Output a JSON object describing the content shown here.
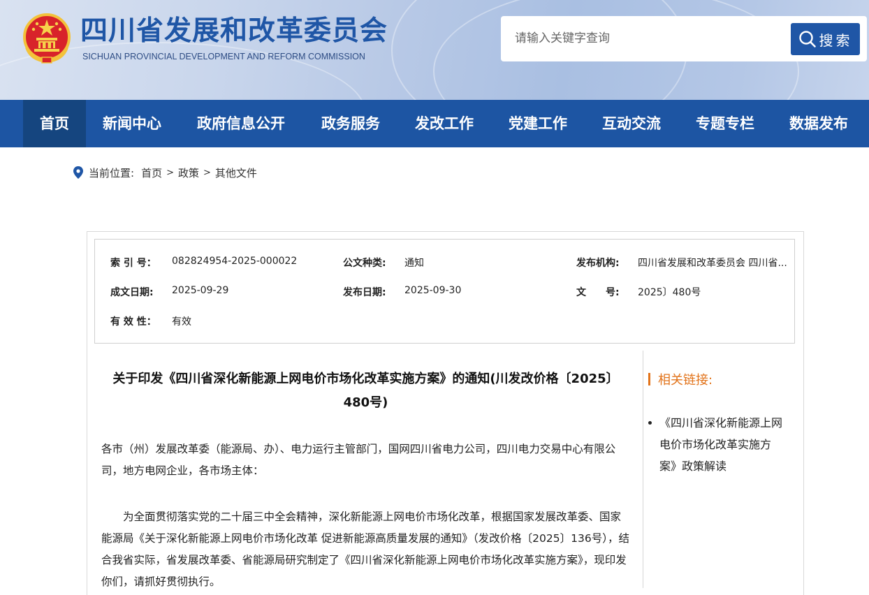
{
  "header": {
    "site_title": "四川省发展和改革委员会",
    "site_subtitle": "SICHUAN PROVINCIAL DEVELOPMENT AND REFORM COMMISSION",
    "emblem_icon": "national-emblem-icon",
    "search": {
      "placeholder": "请输入关键字查询",
      "button_label": "搜索",
      "button_icon": "search-icon"
    },
    "colors": {
      "brand_blue": "#1f56a6",
      "nav_blue": "#1d55a3",
      "nav_active": "#15457f"
    }
  },
  "nav": {
    "items": [
      {
        "label": "首页",
        "active": true
      },
      {
        "label": "新闻中心"
      },
      {
        "label": "政府信息公开"
      },
      {
        "label": "政务服务"
      },
      {
        "label": "发改工作"
      },
      {
        "label": "党建工作"
      },
      {
        "label": "互动交流"
      },
      {
        "label": "专题专栏"
      },
      {
        "label": "数据发布"
      }
    ]
  },
  "breadcrumb": {
    "label": "当前位置:",
    "icon": "location-pin-icon",
    "items": [
      "首页",
      "政策",
      "其他文件"
    ],
    "separator": ">"
  },
  "meta": {
    "index_no_label": "索 引 号：",
    "index_no": "082824954-2025-000022",
    "doc_type_label": "公文种类:",
    "doc_type": "通知",
    "publisher_label": "发布机构:",
    "publisher": "四川省发展和改革委员会 四川省...",
    "written_date_label": "成文日期:",
    "written_date": "2025-09-29",
    "publish_date_label": "发布日期:",
    "publish_date": "2025-09-30",
    "doc_no_label": "文　　号:",
    "doc_no": "2025〕480号",
    "validity_label": "有 效 性：",
    "validity": "有效"
  },
  "article": {
    "title": "关于印发《四川省深化新能源上网电价市场化改革实施方案》的通知(川发改价格〔2025〕480号)",
    "addressee": "各市（州）发展改革委（能源局、办）、电力运行主管部门，国网四川省电力公司，四川电力交易中心有限公司，地方电网企业，各市场主体：",
    "body": "为全面贯彻落实党的二十届三中全会精神，深化新能源上网电价市场化改革，根据国家发展改革委、国家能源局《关于深化新能源上网电价市场化改革 促进新能源高质量发展的通知》（发改价格〔2025〕136号），结合我省实际，省发展改革委、省能源局研究制定了《四川省深化新能源上网电价市场化改革实施方案》，现印发你们，请抓好贯彻执行。"
  },
  "related": {
    "heading": "相关链接:",
    "accent_color": "#e2731a",
    "links": [
      "《四川省深化新能源上网电价市场化改革实施方案》政策解读"
    ]
  }
}
